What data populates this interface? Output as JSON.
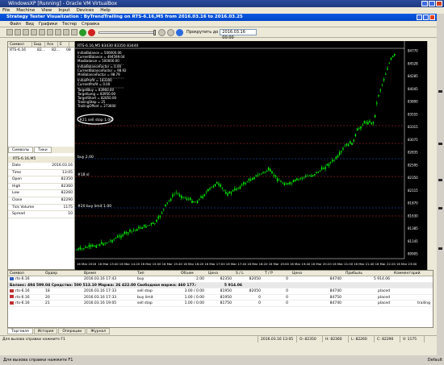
{
  "vbox": {
    "title": "WindowsXP [Running] - Oracle VM VirtualBox",
    "menu": [
      "File",
      "Machine",
      "View",
      "Input",
      "Devices",
      "Help"
    ],
    "status": "Для вызова справки нажмите F1",
    "status_right": "Default"
  },
  "app": {
    "title": "Strategy Tester Visualization : ByTrendTrailing on RTS-6.16,M5 from 2016.03.16 to 2016.03.25",
    "menu": [
      "Файл",
      "Вид",
      "Графики",
      "Тестер",
      "Справка"
    ],
    "skip_label": "Прокрутить до",
    "skip_date": "2016.03.16 00:00"
  },
  "market_watch": {
    "headers": [
      "Символ",
      "Бид",
      "Аск",
      "Е"
    ],
    "rows": [
      [
        "RTS-6.16",
        "82...",
        "82...",
        "08"
      ]
    ],
    "tabs": [
      "Символы",
      "Тики"
    ]
  },
  "data_window": {
    "title": "RTS-6.16,M5",
    "rows": [
      {
        "k": "Date",
        "v": "2016.03.16"
      },
      {
        "k": "Time",
        "v": "13:05"
      },
      {
        "k": "Open",
        "v": "82350"
      },
      {
        "k": "High",
        "v": "82360"
      },
      {
        "k": "Low",
        "v": "82260"
      },
      {
        "k": "Close",
        "v": "82290"
      },
      {
        "k": "Tick Volume",
        "v": "1175"
      },
      {
        "k": "Spread",
        "v": "10"
      }
    ]
  },
  "chart": {
    "header": "RTS-6.16,M5 83430 83350 83440",
    "info_lines": [
      "InitialBalance = 500000.00",
      "CurrentBalance = 494599.04",
      "MaxBalance = 500000.00",
      "InitialBalanceFactor = 0.00",
      "CurrentBalanceFactor = 98.92",
      "MinBalanceFactor = 98.79",
      "InitialProfit = 183300",
      "CurrentProfit = 0.00",
      "TargetBuy = 83960.00",
      "TargetLong = 83950.00",
      "TargetShort = 82850.00",
      "TrailingStep = 25",
      "TrailingOffset = 273600"
    ],
    "circled_label": "#21 sell stop 1.00",
    "line_labels": {
      "buy": "buy 2.00",
      "sell": "#18 sl",
      "buylimit": "#20 buy limit 1.00"
    },
    "price_labels": [
      "84770",
      "84528",
      "84285",
      "84045",
      "83800",
      "83555",
      "83315",
      "83075",
      "82835",
      "82595",
      "82350",
      "82115",
      "81870",
      "81630",
      "81385",
      "81145",
      "80905"
    ],
    "time_labels": [
      "16 Mar 2016",
      "16 Mar 13:40",
      "16 Mar 14:20",
      "16 Mar 15:00",
      "16 Mar 15:40",
      "16 Mar 16:20",
      "16 Mar 17:00",
      "16 Mar 17:40",
      "16 Mar 18:20",
      "16 Mar 19:00",
      "16 Mar 19:40",
      "16 Mar 20:20",
      "16 Mar 21:00",
      "16 Mar 21:40",
      "16 Mar 22:20",
      "16 Mar 23:00"
    ]
  },
  "trade": {
    "headers": [
      "Символ",
      "Ордер",
      "Время",
      "Тип",
      "Объем",
      "Цена",
      "S / L",
      "T / P",
      "Цена",
      "Прибыль",
      "Комментарий"
    ],
    "rows": [
      {
        "sym": "rts-6.16",
        "ord": "",
        "time": "2016.03.16 17:43",
        "type": "buy",
        "vol": "2.00",
        "price": "82350",
        "sl": "82050",
        "tp": "0",
        "cur": "84740",
        "profit": "5 914.06",
        "comment": ""
      },
      {
        "sym": "rts-6.16",
        "ord": "18",
        "time": "2016.03.16 17:33",
        "type": "sell stop",
        "vol": "3.00 / 0.00",
        "price": "81950",
        "sl": "82050",
        "tp": "0",
        "cur": "84740",
        "profit": "placed",
        "comment": ""
      },
      {
        "sym": "rts-6.16",
        "ord": "20",
        "time": "2016.03.16 17:33",
        "type": "buy limit",
        "vol": "1.00 / 0.00",
        "price": "81950",
        "sl": "0",
        "tp": "0",
        "cur": "84750",
        "profit": "placed",
        "comment": ""
      },
      {
        "sym": "rts-6.16",
        "ord": "21",
        "time": "2016.03.16 19:05",
        "type": "sell stop",
        "vol": "1.00 / 0.00",
        "price": "81750",
        "sl": "0",
        "tp": "0",
        "cur": "84740",
        "profit": "placed",
        "comment": "trailing"
      }
    ],
    "balance_line": "Баланс: 494 599.04  Средства: 500 513.10  Маржа: 26 422.00  Свободная маржа: 460 177.04  Уровень маржи: 1 894.30 %",
    "balance_profit": "5 914.06",
    "tabs": [
      "Торговля",
      "История",
      "Операции",
      "Журнал"
    ]
  },
  "status_bar": [
    "Для вызова справки нажмите F1",
    "2016.03.16 13:05",
    "O: 82350",
    "H: 82360",
    "L: 82260",
    "C: 82290",
    "V: 1175"
  ]
}
